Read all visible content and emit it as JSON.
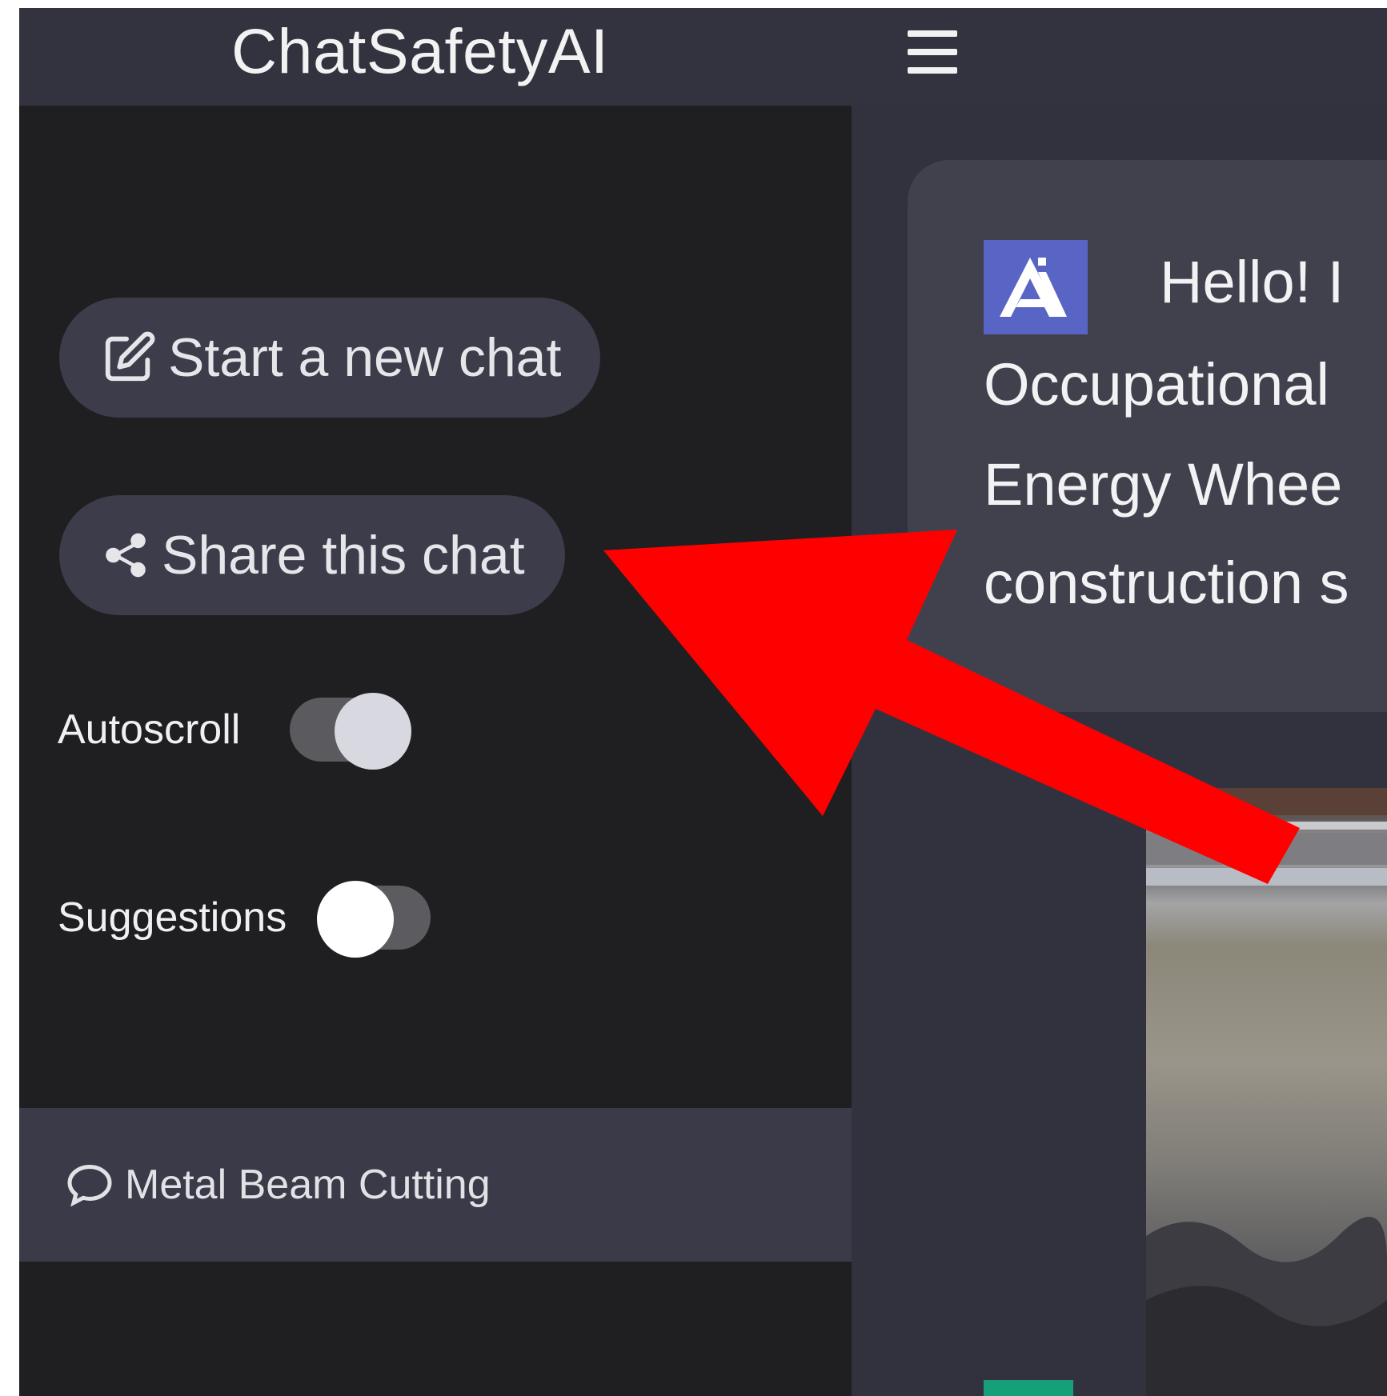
{
  "app": {
    "title": "ChatSafetyAI"
  },
  "header": {
    "menu_icon": "hamburger-menu-icon"
  },
  "sidebar": {
    "new_chat_label": "Start a new chat",
    "share_chat_label": "Share this chat",
    "toggles": [
      {
        "label": "Autoscroll",
        "on": true
      },
      {
        "label": "Suggestions",
        "on": false
      }
    ],
    "history": [
      {
        "label": "Metal Beam Cutting",
        "icon": "chat-bubble-icon"
      }
    ]
  },
  "chat": {
    "bot_message": {
      "greeting": "Hello! I",
      "line1": "Occupational",
      "line2": "Energy Whee",
      "line3": "construction s"
    }
  },
  "colors": {
    "sidebar_bg": "#1f1f22",
    "main_bg": "#32323f",
    "button_bg": "#3c3c4b",
    "bot_avatar": "#5865c4",
    "user_avatar": "#16a07a",
    "annotation_arrow": "#ff0000"
  }
}
